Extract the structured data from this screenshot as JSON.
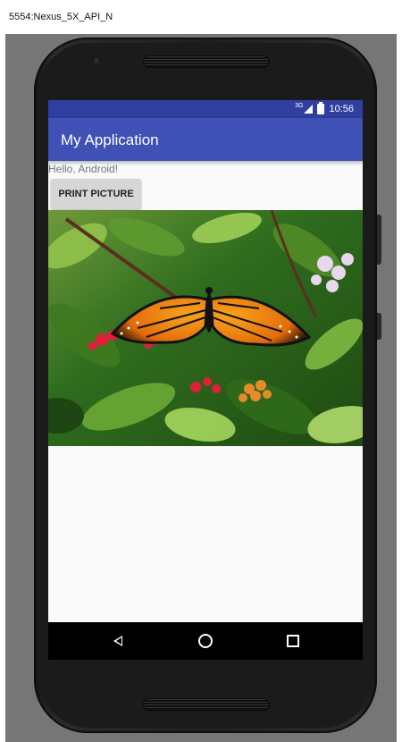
{
  "window": {
    "title": "5554:Nexus_5X_API_N"
  },
  "status_bar": {
    "network_type": "3G",
    "time": "10:56",
    "icons": [
      "signal-icon",
      "battery-icon"
    ],
    "color": "#303f9f"
  },
  "app_bar": {
    "title": "My Application",
    "color": "#3f51b5"
  },
  "content": {
    "hello_text": "Hello, Android!",
    "print_button_label": "PRINT PICTURE",
    "image": "monarch-butterfly-on-flowers"
  },
  "nav_bar": {
    "buttons": [
      "back-icon",
      "home-icon",
      "recents-icon"
    ]
  }
}
